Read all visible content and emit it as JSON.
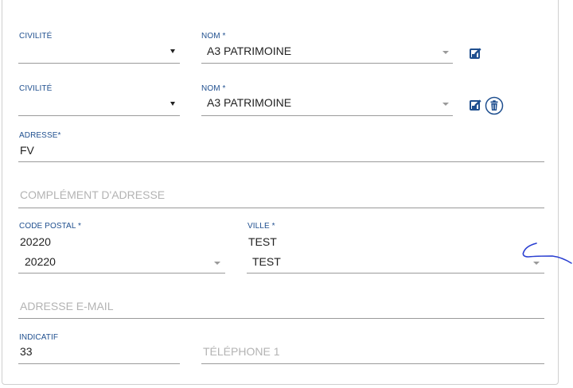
{
  "contact_row_1": {
    "civilite_label": "CIVILITÉ",
    "civilite_value": "",
    "nom_label": "NOM *",
    "nom_value": "A3 PATRIMOINE"
  },
  "contact_row_2": {
    "civilite_label": "CIVILITÉ",
    "civilite_value": "",
    "nom_label": "NOM *",
    "nom_value": "A3 PATRIMOINE"
  },
  "address": {
    "label": "ADRESSE*",
    "value": "FV",
    "complement_placeholder": "COMPLÉMENT D'ADRESSE"
  },
  "postal": {
    "code_label": "CODE POSTAL *",
    "code_text": "20220",
    "code_select_value": "20220",
    "ville_label": "VILLE *",
    "ville_text": "TEST",
    "ville_select_value": "TEST"
  },
  "email": {
    "placeholder": "ADRESSE E-MAIL"
  },
  "phone": {
    "indicatif_label": "INDICATIF",
    "indicatif_value": "33",
    "telephone_placeholder": "TÉLÉPHONE 1"
  },
  "colors": {
    "label_blue": "#1f4f8f",
    "icon_blue": "#1f4f8f",
    "annotation_blue": "#2a3fd1"
  },
  "icons": {
    "edit": "edit-icon",
    "delete": "trash-icon"
  }
}
